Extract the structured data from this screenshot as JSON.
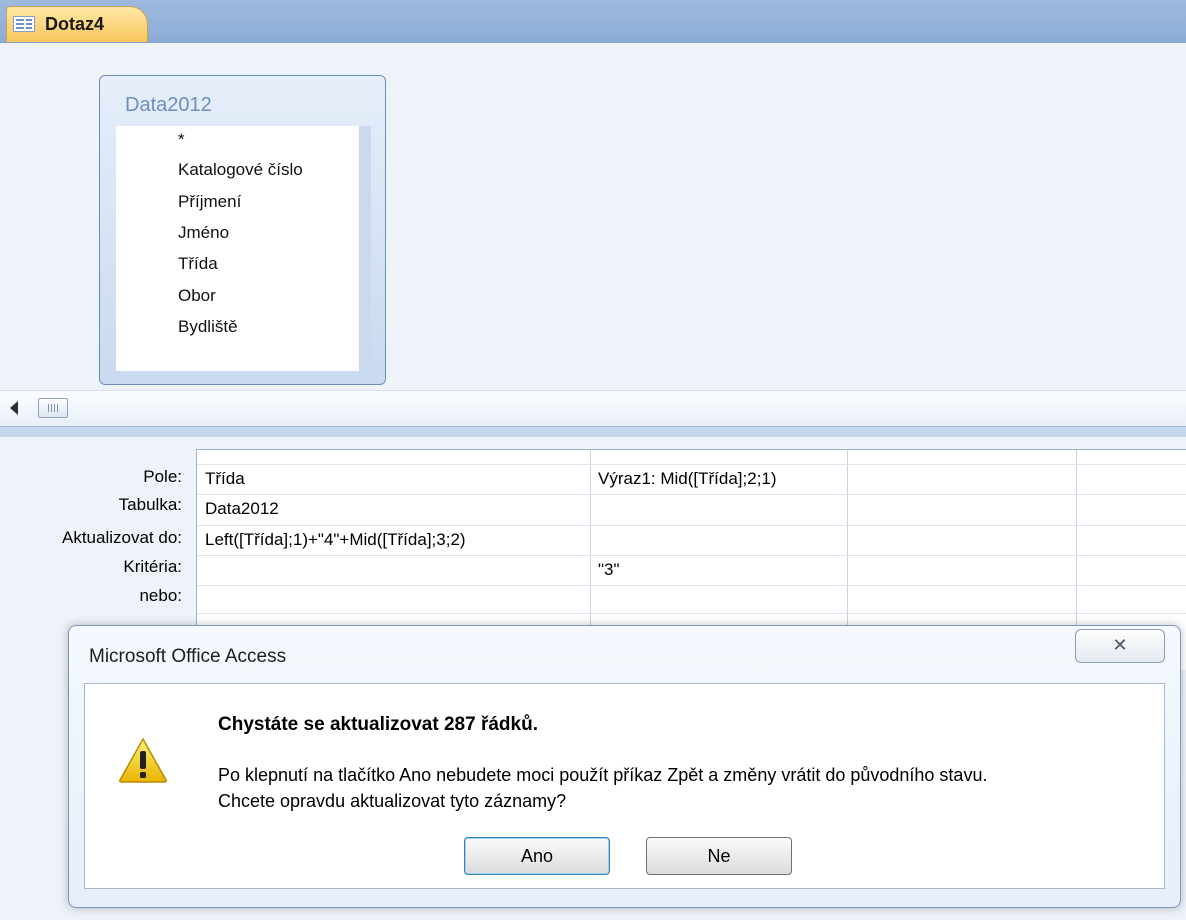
{
  "tab": {
    "label": "Dotaz4"
  },
  "table_box": {
    "title": "Data2012",
    "fields": [
      "*",
      "Katalogové číslo",
      "Příjmení",
      "Jméno",
      "Třída",
      "Obor",
      "Bydliště"
    ]
  },
  "grid": {
    "row_labels": [
      "Pole:",
      "Tabulka:",
      "Aktualizovat do:",
      "Kritéria:",
      "nebo:"
    ],
    "columns": [
      {
        "pole": "Třída",
        "tabulka": "Data2012",
        "aktualizovat": "Left([Třída];1)+\"4\"+Mid([Třída];3;2)",
        "kriteria": "",
        "nebo": ""
      },
      {
        "pole": "Výraz1: Mid([Třída];2;1)",
        "tabulka": "",
        "aktualizovat": "",
        "kriteria": "\"3\"",
        "nebo": ""
      }
    ]
  },
  "dialog": {
    "title": "Microsoft Office Access",
    "close_glyph": "✕",
    "heading": "Chystáte se aktualizovat 287 řádků.",
    "line1": "Po klepnutí na tlačítko Ano nebudete moci použít příkaz Zpět a změny vrátit do původního stavu.",
    "line2": "Chcete opravdu aktualizovat tyto záznamy?",
    "yes_label": "Ano",
    "no_label": "Ne"
  }
}
